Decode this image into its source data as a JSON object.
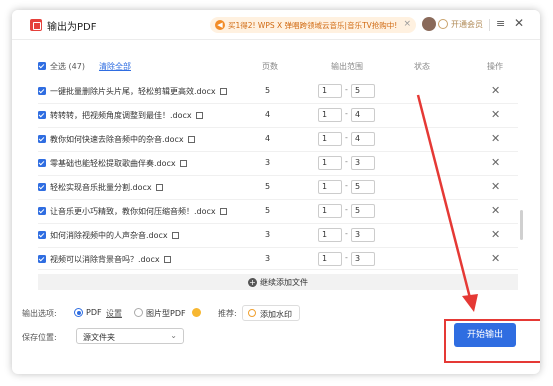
{
  "window": {
    "title": "输出为PDF"
  },
  "promo": {
    "text": "买1得2! WPS X 弹唱跨领域云音乐|音乐TV抢购中!",
    "close": "×"
  },
  "account": {
    "vip_label": "开通会员"
  },
  "titlebar": {
    "menu_glyph": "≡",
    "close_glyph": "✕"
  },
  "table": {
    "select_all_label": "全选 (47)",
    "clear_all_label": "清除全部",
    "columns": {
      "pages": "页数",
      "range": "输出范围",
      "status": "状态",
      "actions": "操作"
    },
    "rows": [
      {
        "name": "一键批量删除片头片尾，轻松剪辑更高效.docx",
        "pages": "5",
        "from": "1",
        "to": "5"
      },
      {
        "name": "转转转，把视频角度调整到最佳！.docx",
        "pages": "4",
        "from": "1",
        "to": "4"
      },
      {
        "name": "教你如何快速去除音频中的杂音.docx",
        "pages": "4",
        "from": "1",
        "to": "4"
      },
      {
        "name": "零基础也能轻松提取歌曲伴奏.docx",
        "pages": "3",
        "from": "1",
        "to": "3"
      },
      {
        "name": "轻松实现音乐批量分割.docx",
        "pages": "5",
        "from": "1",
        "to": "5"
      },
      {
        "name": "让音乐更小巧精致，教你如何压缩音频！.docx",
        "pages": "5",
        "from": "1",
        "to": "5"
      },
      {
        "name": "如何消除视频中的人声杂音.docx",
        "pages": "3",
        "from": "1",
        "to": "3"
      },
      {
        "name": "视频可以消除背景音吗？.docx",
        "pages": "3",
        "from": "1",
        "to": "3"
      }
    ],
    "range_separator": "-",
    "delete_glyph": "✕"
  },
  "add_files": {
    "label": "继续添加文件",
    "plus": "+"
  },
  "options": {
    "output_label": "输出选项:",
    "pdf_label": "PDF",
    "settings_label": "设置",
    "image_pdf_label": "图片型PDF",
    "recommend_label": "推荐:",
    "watermark_label": "添加水印",
    "save_label": "保存位置:",
    "save_location": "源文件夹"
  },
  "start_button": {
    "label": "开始输出"
  },
  "colors": {
    "accent": "#2f6de1",
    "annotation": "#e53935"
  }
}
